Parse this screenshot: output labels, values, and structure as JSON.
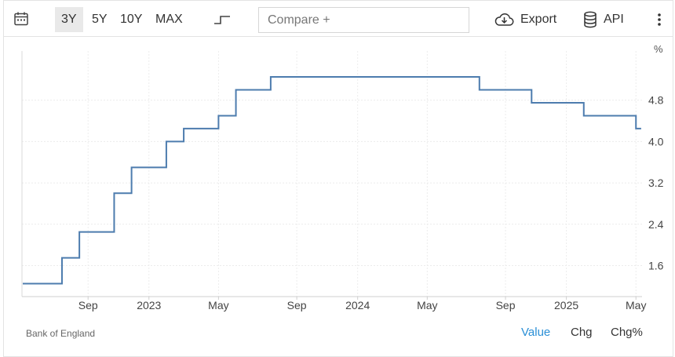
{
  "toolbar": {
    "calendar_icon": "calendar-icon",
    "ranges": [
      "3Y",
      "5Y",
      "10Y",
      "MAX"
    ],
    "active_range": "3Y",
    "step_icon": "step-line-icon",
    "compare_placeholder": "Compare +",
    "export_label": "Export",
    "api_label": "API",
    "more_icon": "vertical-dots-icon"
  },
  "chart_data": {
    "type": "line",
    "step": true,
    "unit": "%",
    "color": "#4d7cae",
    "y_ticks": [
      1.6,
      2.4,
      3.2,
      4.0,
      4.8
    ],
    "ylim": [
      1.0,
      5.6
    ],
    "x_ticks": [
      "Sep",
      "2023",
      "May",
      "Sep",
      "2024",
      "May",
      "Sep",
      "2025",
      "May"
    ],
    "grid": true,
    "y_axis_position": "right",
    "series": [
      {
        "points": [
          {
            "x": "2022-06",
            "y": 1.25
          },
          {
            "x": "2022-08",
            "y": 1.75
          },
          {
            "x": "2022-09",
            "y": 2.25
          },
          {
            "x": "2022-11",
            "y": 3.0
          },
          {
            "x": "2022-12",
            "y": 3.5
          },
          {
            "x": "2023-02",
            "y": 4.0
          },
          {
            "x": "2023-03",
            "y": 4.25
          },
          {
            "x": "2023-05",
            "y": 4.5
          },
          {
            "x": "2023-06",
            "y": 5.0
          },
          {
            "x": "2023-08",
            "y": 5.25
          },
          {
            "x": "2024-08",
            "y": 5.0
          },
          {
            "x": "2024-11",
            "y": 4.75
          },
          {
            "x": "2025-02",
            "y": 4.5
          },
          {
            "x": "2025-05",
            "y": 4.25
          }
        ]
      }
    ]
  },
  "footer": {
    "source": "Bank of England",
    "tabs": [
      "Value",
      "Chg",
      "Chg%"
    ],
    "active_tab": "Value"
  }
}
